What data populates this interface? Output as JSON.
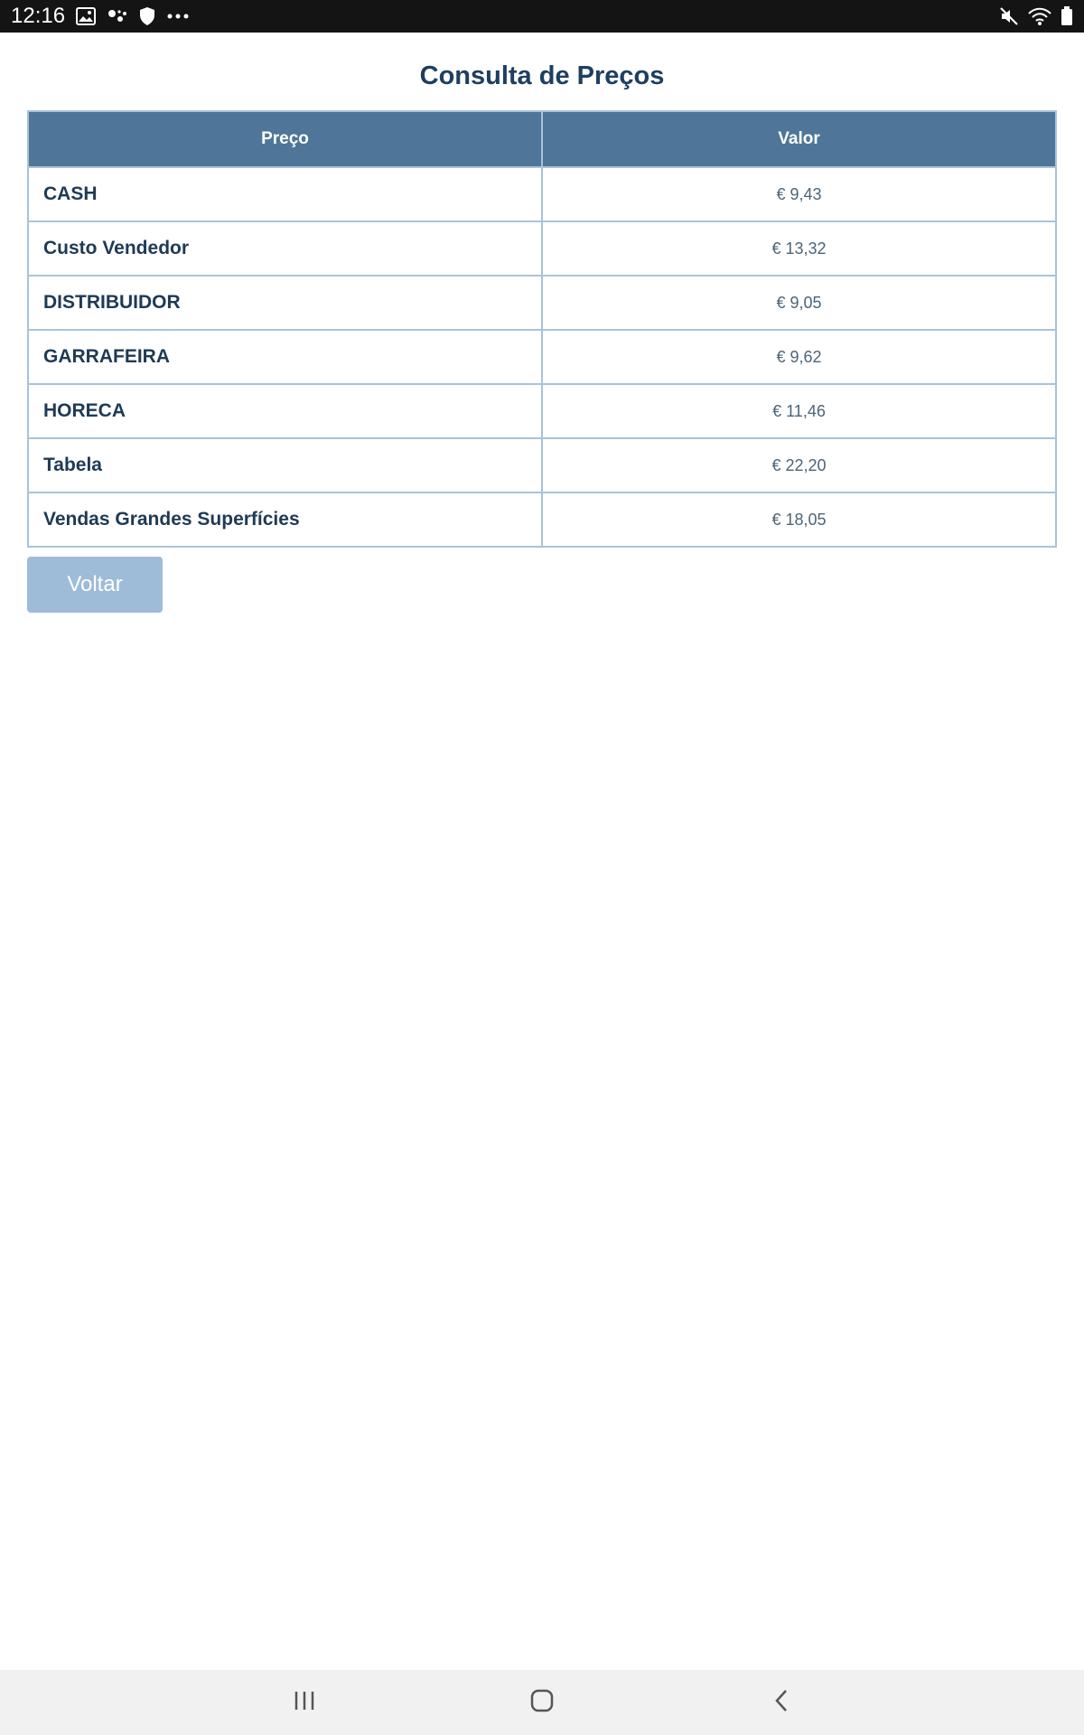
{
  "status_bar": {
    "time": "12:16",
    "icons_left": [
      "image-icon",
      "assistant-icon",
      "shield-icon",
      "more-dots-icon"
    ],
    "icons_right": [
      "mute-icon",
      "wifi-icon",
      "battery-icon"
    ]
  },
  "page": {
    "title": "Consulta de Preços"
  },
  "table": {
    "headers": {
      "name": "Preço",
      "value": "Valor"
    },
    "rows": [
      {
        "name": "CASH",
        "value": "€ 9,43"
      },
      {
        "name": "Custo Vendedor",
        "value": "€ 13,32"
      },
      {
        "name": "DISTRIBUIDOR",
        "value": "€ 9,05"
      },
      {
        "name": "GARRAFEIRA",
        "value": "€ 9,62"
      },
      {
        "name": "HORECA",
        "value": "€ 11,46"
      },
      {
        "name": "Tabela",
        "value": "€ 22,20"
      },
      {
        "name": "Vendas Grandes Superfícies",
        "value": "€ 18,05"
      }
    ]
  },
  "actions": {
    "back_label": "Voltar"
  },
  "nav_bar": {
    "buttons": [
      "recent-apps-icon",
      "home-icon",
      "back-icon"
    ]
  },
  "colors": {
    "title": "#1e3f60",
    "header_bg": "#4f7698",
    "border": "#a9c3da",
    "button_bg": "#9ebcd8"
  }
}
